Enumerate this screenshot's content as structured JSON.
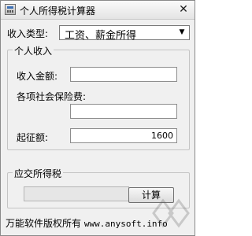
{
  "window": {
    "title": "个人所得税计算器",
    "close_glyph": "✕"
  },
  "income_type": {
    "label": "收入类型:",
    "value": "工资、薪金所得",
    "arrow": "▼"
  },
  "personal_income_group": {
    "legend": "个人收入",
    "income_amount_label": "收入金额:",
    "income_amount_value": "",
    "social_insurance_label": "各项社会保险费:",
    "social_insurance_value": "",
    "threshold_label": "起征额:",
    "threshold_value": "1600"
  },
  "tax_due_group": {
    "legend": "应交所得税",
    "result_value": "",
    "calculate_button": "计算"
  },
  "footer": {
    "copyright": "万能软件版权所有",
    "url": "www.anysoft.info"
  }
}
